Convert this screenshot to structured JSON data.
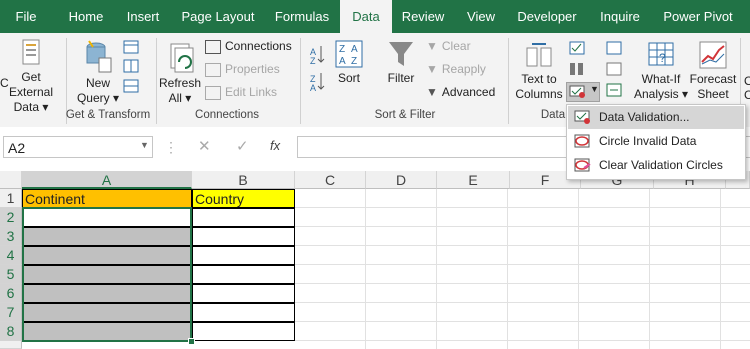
{
  "tabs": [
    "File",
    "Home",
    "Insert",
    "Page Layout",
    "Formulas",
    "Data",
    "Review",
    "View",
    "Developer",
    "Inquire",
    "Power Pivot"
  ],
  "ribbon": {
    "get_external": [
      "Get External",
      "Data ▾"
    ],
    "new_query": [
      "New",
      "Query ▾"
    ],
    "connections": "Connections",
    "properties": "Properties",
    "edit_links": "Edit Links",
    "refresh": [
      "Refresh",
      "All ▾"
    ],
    "sort": "Sort",
    "filter": "Filter",
    "clear": "Clear",
    "reapply": "Reapply",
    "advanced": "Advanced",
    "text_to_columns": [
      "Text to",
      "Columns"
    ],
    "what_if": [
      "What-If",
      "Analysis ▾"
    ],
    "forecast": [
      "Forecast",
      "Sheet"
    ],
    "edge_o": "O",
    "edge_c": "C",
    "groups": {
      "get_transform": "Get & Transform",
      "connections": "Connections",
      "sort_filter": "Sort & Filter",
      "data_tools": "Data"
    }
  },
  "formula_bar": {
    "name_box": "A2",
    "fx": "fx"
  },
  "columns": [
    "A",
    "B",
    "C",
    "D",
    "E",
    "F",
    "G",
    "H"
  ],
  "rows": [
    "1",
    "2",
    "3",
    "4",
    "5",
    "6",
    "7",
    "8"
  ],
  "cells": {
    "A1": "Continent",
    "B1": "Country"
  },
  "colors": {
    "excel_green": "#217346",
    "header_fill": "#ffc000",
    "country_fill": "#ffff00",
    "grey_fill": "#c0c0c0"
  },
  "dropdown": {
    "items": [
      "Data Validation...",
      "Circle Invalid Data",
      "Clear Validation Circles"
    ],
    "highlighted": "Data Validation..."
  }
}
